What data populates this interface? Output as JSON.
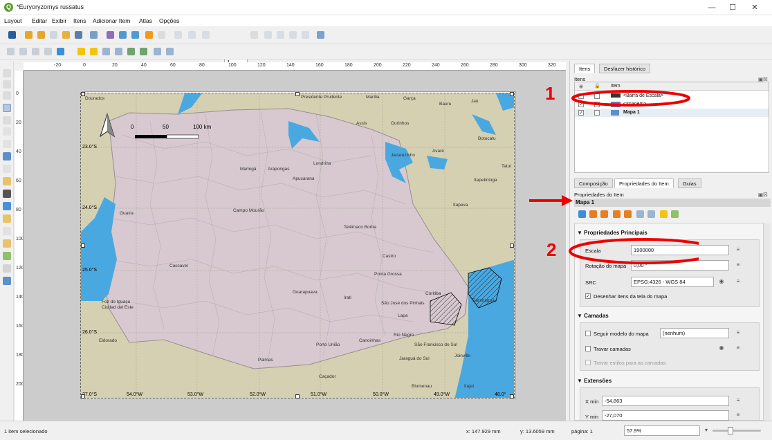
{
  "window": {
    "title": "*Euryoryzomys russatus"
  },
  "menu": [
    "Layout",
    "Editar",
    "Exibir",
    "Itens",
    "Adicionar Item",
    "Atlas",
    "Opções"
  ],
  "toolbar": {
    "page_value": "1"
  },
  "ruler_top_labels": [
    "-20",
    "0",
    "20",
    "40",
    "60",
    "80",
    "100",
    "120",
    "140",
    "160",
    "180",
    "200",
    "220",
    "240",
    "260",
    "280",
    "300",
    "320"
  ],
  "ruler_left_labels": [
    "0",
    "20",
    "40",
    "60",
    "80",
    "100",
    "120",
    "140",
    "160",
    "180",
    "200"
  ],
  "map": {
    "scalebar": {
      "labels": [
        "0",
        "50",
        "100 km"
      ]
    },
    "lat_labels": [
      "23.0°S",
      "24.0°S",
      "25.0°S",
      "26.0°S",
      "27.0°S"
    ],
    "lon_labels": [
      "54.0°W",
      "53.0°W",
      "52.0°W",
      "51.0°W",
      "50.0°W",
      "49.0°W",
      "48.0°"
    ],
    "places": [
      "Dourados",
      "Presidente Prudente",
      "Marília",
      "Garça",
      "Bauru",
      "Jaú",
      "Assis",
      "Ourinhos",
      "Botucatu",
      "Avaré",
      "Maringá",
      "Arapongas",
      "Londrina",
      "Apucarana",
      "Itapetininga",
      "Tatuí",
      "Guaíra",
      "Campo Mourão",
      "Itapeva",
      "Telêmaco Borba",
      "Castro",
      "Cascavel",
      "Ponta Grossa",
      "Guarapuava",
      "Irati",
      "Curitiba",
      "São José dos Pinhais",
      "Paranaguá",
      "Foz do Iguaçu",
      "Ciudad del Este",
      "Lapa",
      "Eldorado",
      "Rio Negro",
      "Porto União",
      "Canoinhas",
      "São Francisco do Sul",
      "Joinville",
      "Palmas",
      "Jaraguá do Sul",
      "Caçador",
      "Blumenau",
      "Itajaí",
      "Jacarezinho"
    ]
  },
  "panel": {
    "tabs_top": [
      "Itens",
      "Desfazer histórico"
    ],
    "items_title": "Itens",
    "items_col": "Item",
    "items": [
      {
        "name": "<Barra de Escala>",
        "visible": false,
        "icon": "scalebar-icon"
      },
      {
        "name": "<Imagem>",
        "visible": true,
        "icon": "image-icon"
      },
      {
        "name": "Mapa 1",
        "visible": true,
        "icon": "map-icon",
        "bold": true
      }
    ],
    "tabs_bottom": [
      "Composição",
      "Propriedades do Item",
      "Guias"
    ],
    "props_title": "Propriedades do Item",
    "item_name": "Mapa 1",
    "main_props": "Propriedades Principais",
    "scale_label": "Escala",
    "scale_value": "1900000",
    "rotation_label": "Rotação do mapa",
    "rotation_value": "0,00 °",
    "crs_label": "SRC",
    "crs_value": "EPSG:4326 - WGS 84",
    "draw_label": "Desenhar itens da tela do mapa",
    "layers_section": "Camadas",
    "follow_theme": "Seguir modelo do mapa",
    "theme_value": "(nenhum)",
    "lock_layers": "Travar camadas",
    "lock_styles": "Travar estilos para as camadas",
    "extents_section": "Extensões",
    "xmin_label": "X min",
    "xmin_value": "-54,863",
    "ymin_label": "Y min",
    "ymin_value": "-27,070"
  },
  "status": {
    "left": "1 item selecionado",
    "x": "x: 147.929 mm",
    "y": "y: 13.6059 mm",
    "page": "página: 1",
    "zoom": "57.9%"
  },
  "annotations": {
    "one": "1",
    "two": "2"
  }
}
